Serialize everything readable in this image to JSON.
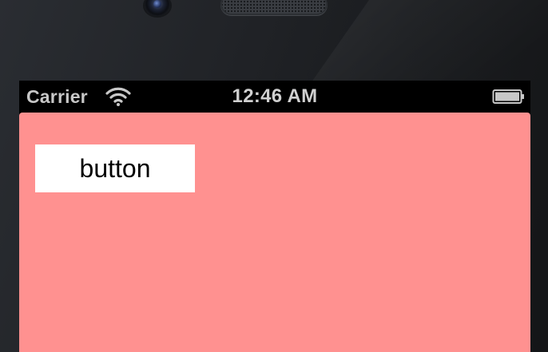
{
  "device": {
    "camera_icon": "front-camera-icon",
    "speaker_icon": "earpiece-speaker-icon"
  },
  "status_bar": {
    "carrier": "Carrier",
    "wifi_icon": "wifi-icon",
    "time": "12:46 AM",
    "battery_icon": "battery-icon"
  },
  "app": {
    "background_color": "#ff9190",
    "button_label": "button"
  }
}
